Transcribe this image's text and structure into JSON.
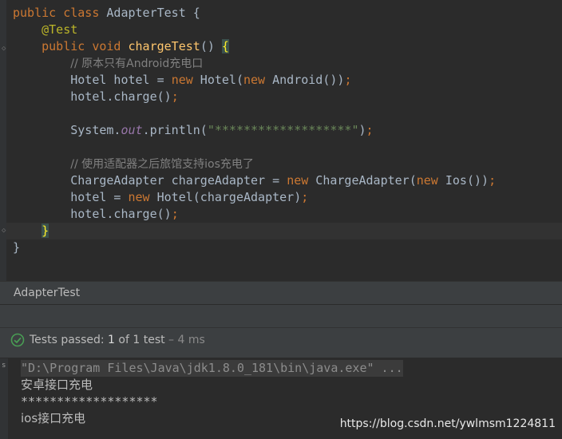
{
  "editor": {
    "lines": {
      "l1": {
        "kw1": "public",
        "kw2": "class",
        "rest": " AdapterTest {"
      },
      "l2": {
        "ann": "@Test"
      },
      "l3": {
        "kw1": "public",
        "kw2": "void",
        "fn": "chargeTest",
        "rest": "() ",
        "brace": "{"
      },
      "l4": {
        "comment": "// 原本只有Android充电口"
      },
      "l5": {
        "a": "Hotel hotel = ",
        "kw": "new",
        "b": " Hotel(",
        "kw2": "new",
        "c": " Android())",
        "semi": ";"
      },
      "l6": {
        "a": "hotel.charge()",
        "semi": ";"
      },
      "l7": {
        "a": "System.",
        "fld": "out",
        "b": ".println(",
        "str": "\"*******************\"",
        "c": ")",
        "semi": ";"
      },
      "l8": {
        "comment": "// 使用适配器之后旅馆支持ios充电了"
      },
      "l9": {
        "a": "ChargeAdapter chargeAdapter = ",
        "kw": "new",
        "b": " ChargeAdapter(",
        "kw2": "new",
        "c": " Ios())",
        "semi": ";"
      },
      "l10": {
        "a": "hotel = ",
        "kw": "new",
        "b": " Hotel(chargeAdapter)",
        "semi": ";"
      },
      "l11": {
        "a": "hotel.charge()",
        "semi": ";"
      },
      "l12": {
        "brace": "}"
      },
      "l13": {
        "brace": "}"
      }
    }
  },
  "run_panel": {
    "title": "AdapterTest",
    "status": {
      "prefix": "Tests passed: ",
      "count": "1",
      "of_text": " of 1 test",
      "duration": " – 4 ms"
    },
    "gutter_label": "s",
    "console": [
      "\"D:\\Program Files\\Java\\jdk1.8.0_181\\bin\\java.exe\" ...",
      "安卓接口充电",
      "*******************",
      "ios接口充电"
    ]
  },
  "watermark": "https://blog.csdn.net/ywlmsm1224811",
  "colors": {
    "background": "#2b2b2b",
    "keyword": "#cc7832",
    "annotation": "#bbb529",
    "method": "#ffc66d",
    "string": "#6a8759",
    "comment": "#808080",
    "pass_green": "#499c54"
  }
}
